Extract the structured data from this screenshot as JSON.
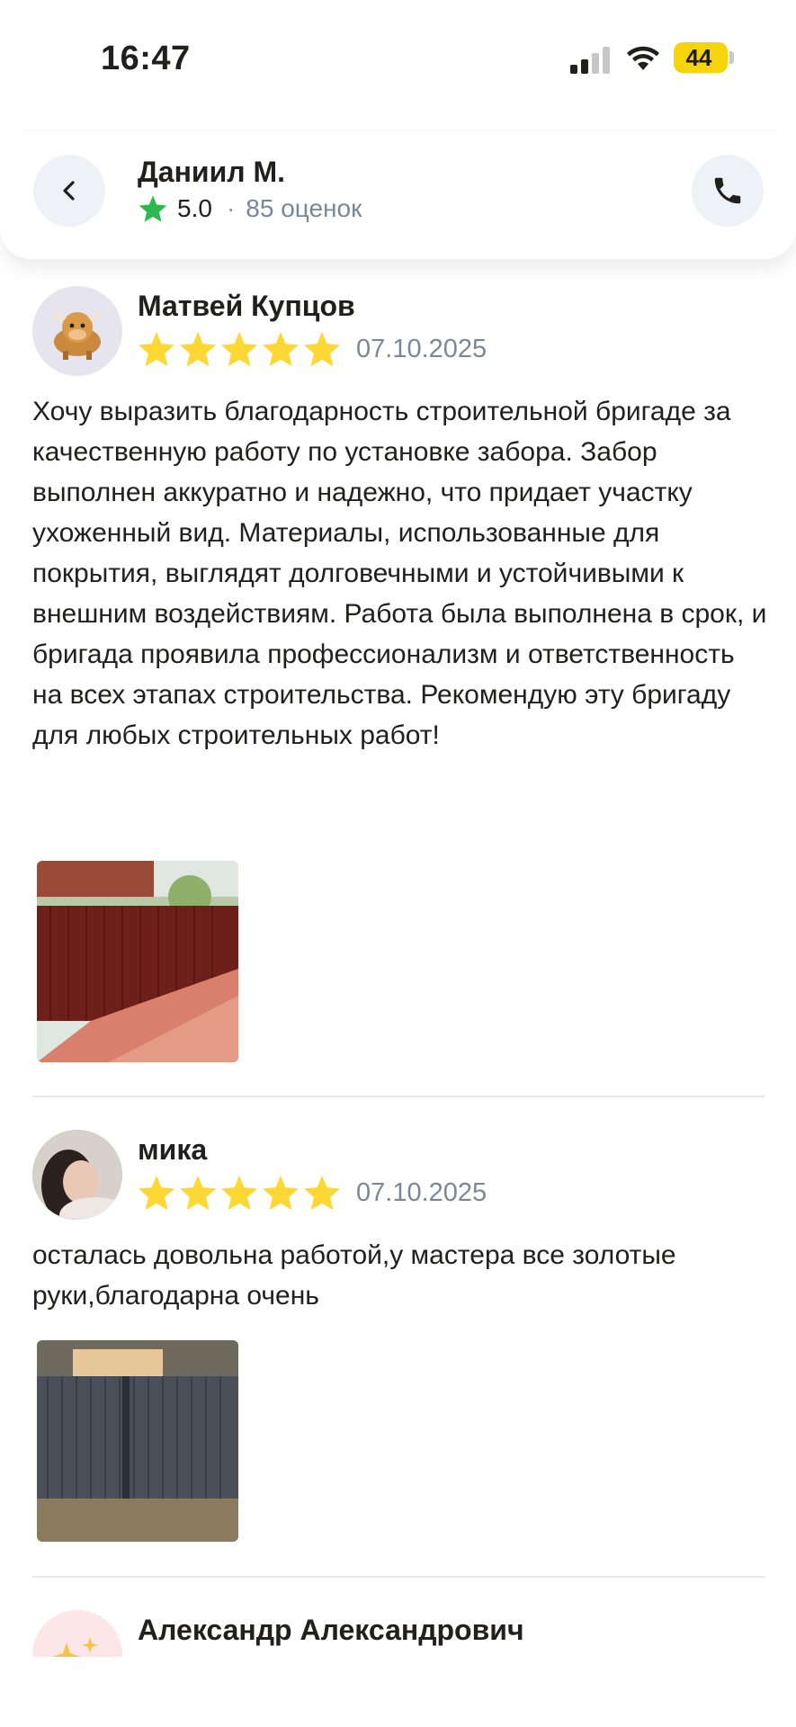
{
  "status_bar": {
    "time": "16:47",
    "battery": "44"
  },
  "header": {
    "name": "Даниил М.",
    "rating": "5.0",
    "separator": "·",
    "count": "85 оценок",
    "accent_star_color": "#2fb84d"
  },
  "reviews": [
    {
      "author": "Матвей Купцов",
      "rating_stars": 5,
      "date": "07.10.2025",
      "text": "Хочу выразить благодарность строительной бригаде за качественную работу по установке забора. Забор выполнен аккуратно и надежно, что придает участку ухоженный вид. Материалы, использованные для покрытия, выглядят долговечными и устойчивыми к внешним воздействиям. Работа была выполнена в срок, и бригада проявила профессионализм и ответственность на всех этапах строительства. Рекомендую эту бригаду для любых строительных работ!"
    },
    {
      "author": "мика",
      "rating_stars": 5,
      "date": "07.10.2025",
      "text": "осталась довольна работой,у мастера все золотые руки,благодарна очень"
    },
    {
      "author": "Александр Александрович"
    }
  ],
  "colors": {
    "star": "#fdd835",
    "muted_text": "#7b8797",
    "divider": "#e4e8ed"
  }
}
